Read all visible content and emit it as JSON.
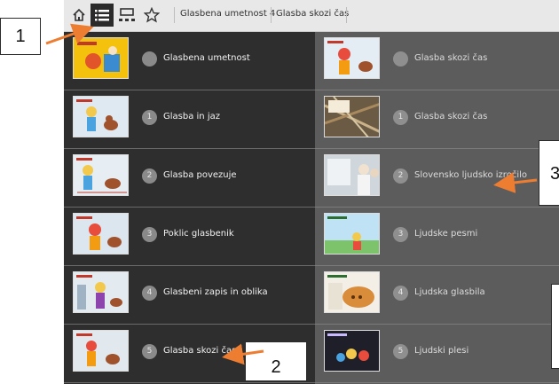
{
  "toolbar": {
    "icons": [
      "home-icon",
      "list-icon",
      "sitemap-icon",
      "star-icon"
    ],
    "breadcrumbs": [
      "Glasbena umetnost 4",
      "Glasba skozi čas"
    ]
  },
  "left_column": [
    {
      "number": "",
      "label": "Glasbena umetnost"
    },
    {
      "number": "1",
      "label": "Glasba in jaz"
    },
    {
      "number": "2",
      "label": "Glasba povezuje"
    },
    {
      "number": "3",
      "label": "Poklic glasbenik"
    },
    {
      "number": "4",
      "label": "Glasbeni zapis in oblika"
    },
    {
      "number": "5",
      "label": "Glasba skozi čas"
    }
  ],
  "right_column": [
    {
      "number": "",
      "label": "Glasba skozi čas"
    },
    {
      "number": "1",
      "label": "Glasba skozi čas"
    },
    {
      "number": "2",
      "label": "Slovensko ljudsko izročilo"
    },
    {
      "number": "3",
      "label": "Ljudske pesmi"
    },
    {
      "number": "4",
      "label": "Ljudska glasbila"
    },
    {
      "number": "5",
      "label": "Ljudski plesi"
    }
  ],
  "callouts": [
    "1",
    "2",
    "3"
  ],
  "colors": {
    "arrow": "#ed7d31",
    "toolbar": "#e8e8e8",
    "left_panel": "#2e2e2e",
    "right_panel": "#5c5c5c"
  }
}
